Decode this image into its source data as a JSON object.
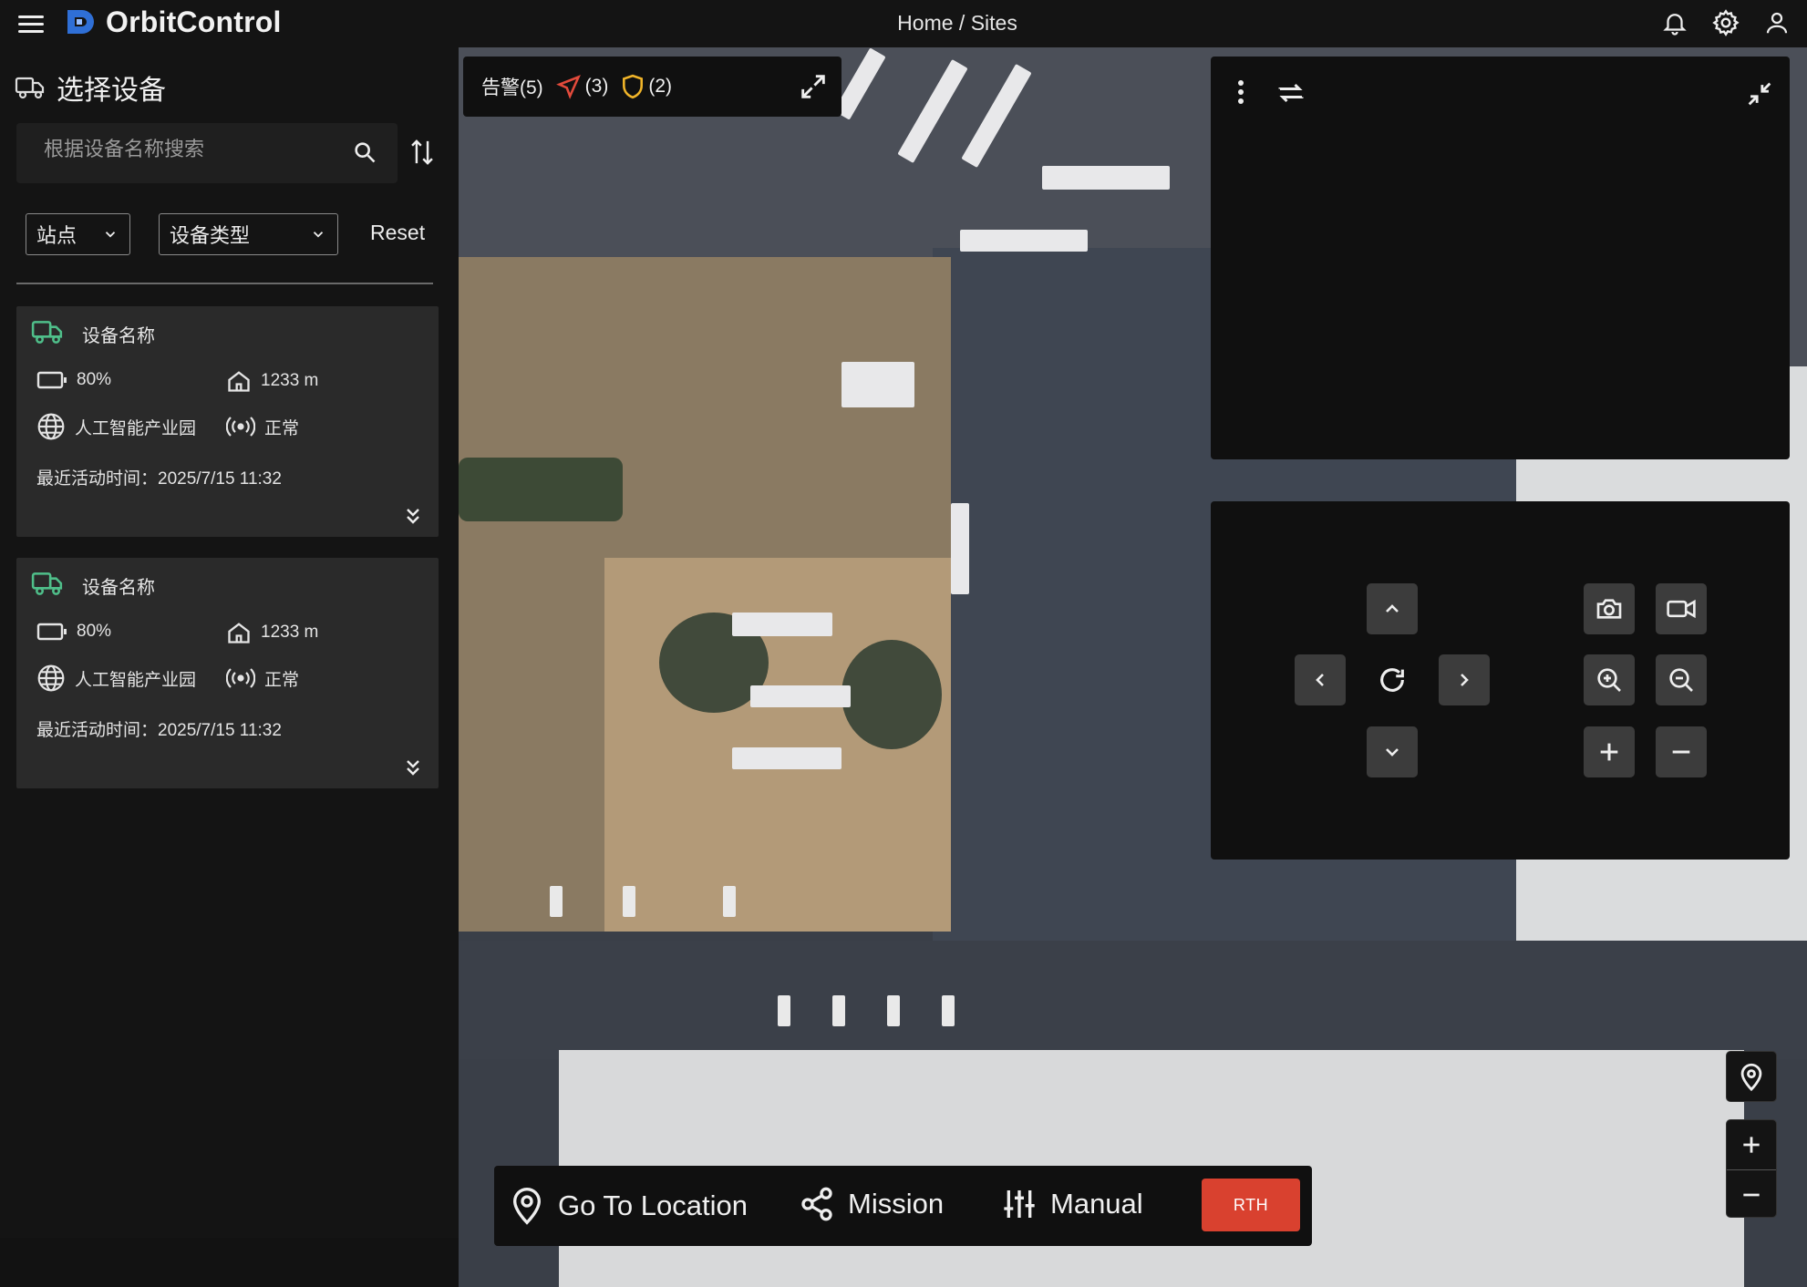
{
  "app": {
    "brand": "OrbitControl",
    "breadcrumb": "Home / Sites"
  },
  "top_icons": [
    "bell-icon",
    "gear-icon",
    "user-icon"
  ],
  "sidebar": {
    "title": "选择设备",
    "search_placeholder": "根据设备名称搜索",
    "filters": {
      "site": "站点",
      "device_type": "设备类型",
      "reset": "Reset"
    },
    "devices": [
      {
        "name": "设备名称",
        "battery": "80%",
        "altitude": "1233 m",
        "site": "人工智能产业园",
        "signal": "正常",
        "last_active": "最近活动时间：2025/7/15 11:32"
      },
      {
        "name": "设备名称",
        "battery": "80%",
        "altitude": "1233 m",
        "site": "人工智能产业园",
        "signal": "正常",
        "last_active": "最近活动时间：2025/7/15 11:32"
      }
    ]
  },
  "alerts": {
    "label": "告警(5)",
    "nav_count": "(3)",
    "shield_count": "(2)"
  },
  "bottom_bar": {
    "goto": "Go To Location",
    "mission": "Mission",
    "manual": "Manual",
    "rth": "RTH"
  },
  "colors": {
    "accent_green": "#4fbf8a",
    "rth_red": "#d9412f",
    "nav_red": "#e24a3b",
    "shield_yellow": "#f0b429",
    "logo_blue": "#2f6fd6"
  }
}
